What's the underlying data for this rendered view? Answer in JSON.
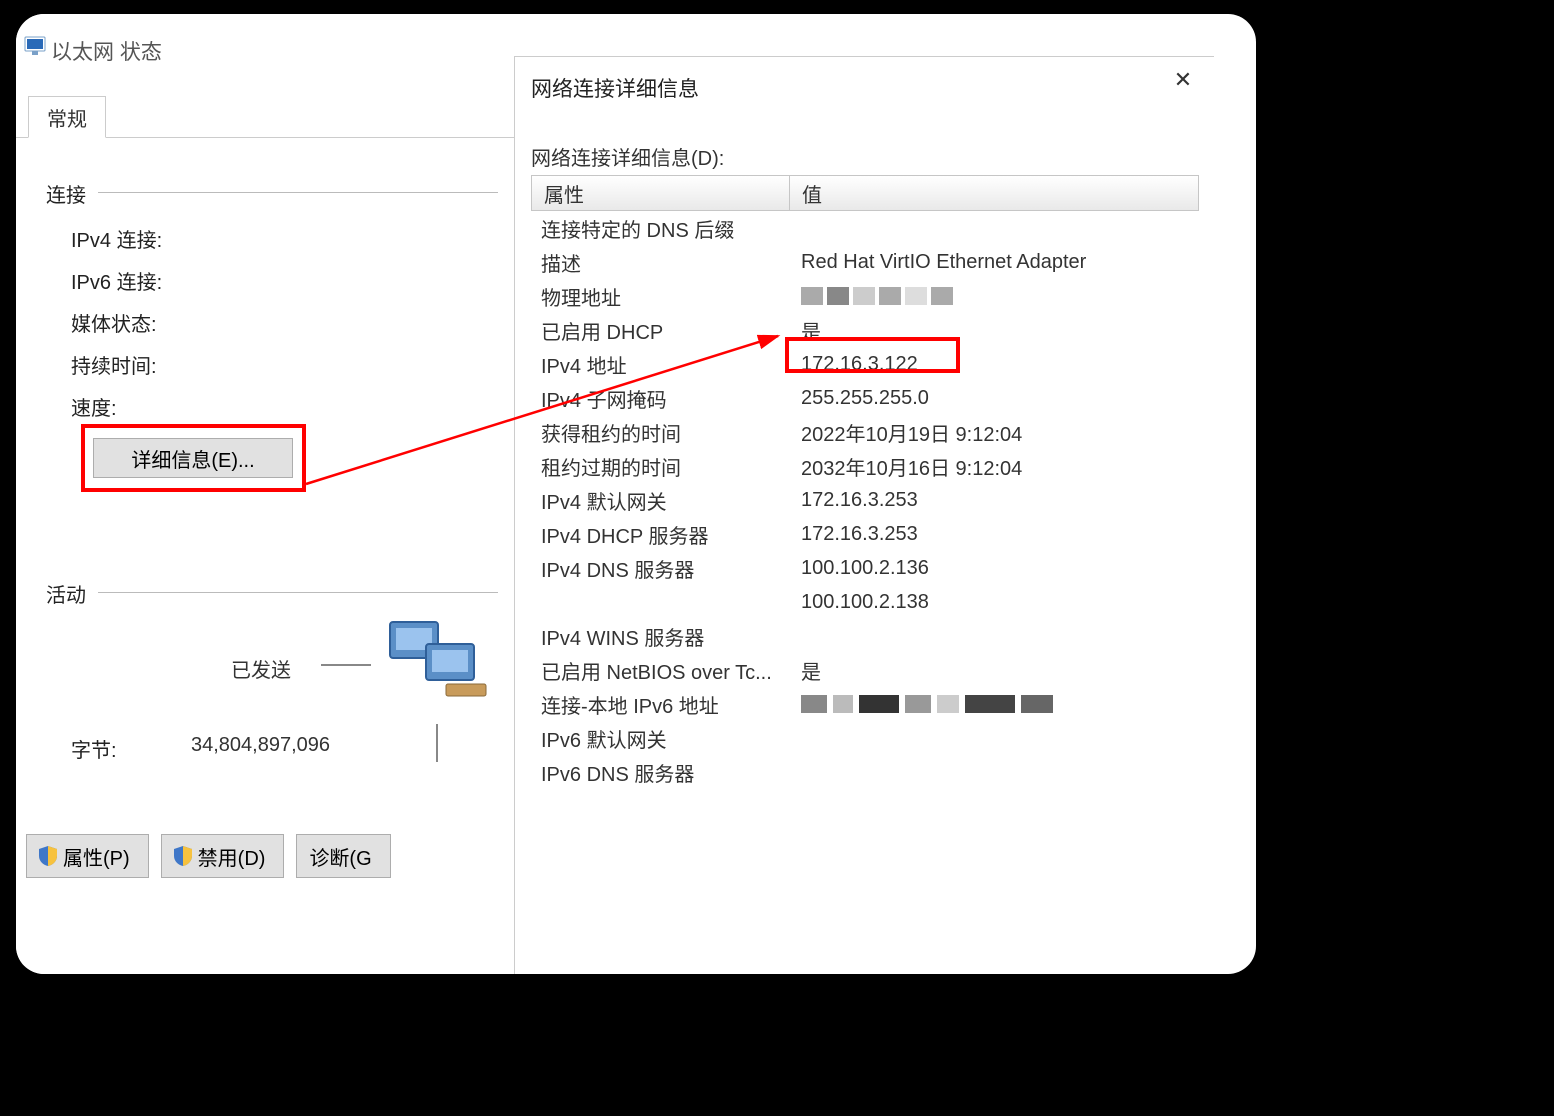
{
  "status": {
    "title": "以太网 状态",
    "tab": "常规",
    "connection_section": "连接",
    "fields": {
      "ipv4": "IPv4 连接:",
      "ipv6": "IPv6 连接:",
      "media": "媒体状态:",
      "duration": "持续时间:",
      "speed": "速度:"
    },
    "details_btn": "详细信息(E)...",
    "activity_section": "活动",
    "sent_label": "已发送",
    "bytes_label": "字节:",
    "bytes_sent": "34,804,897,096",
    "buttons": {
      "properties": "属性(P)",
      "disable": "禁用(D)",
      "diagnose": "诊断(G"
    }
  },
  "details": {
    "title": "网络连接详细信息",
    "subtitle": "网络连接详细信息(D):",
    "header_property": "属性",
    "header_value": "值",
    "rows": [
      {
        "prop": "连接特定的 DNS 后缀",
        "val": ""
      },
      {
        "prop": "描述",
        "val": "Red Hat VirtIO Ethernet Adapter"
      },
      {
        "prop": "物理地址",
        "val": "__MAC__"
      },
      {
        "prop": "已启用 DHCP",
        "val": "是"
      },
      {
        "prop": "IPv4 地址",
        "val": "172.16.3.122"
      },
      {
        "prop": "IPv4 子网掩码",
        "val": "255.255.255.0"
      },
      {
        "prop": "获得租约的时间",
        "val": "2022年10月19日 9:12:04"
      },
      {
        "prop": "租约过期的时间",
        "val": "2032年10月16日 9:12:04"
      },
      {
        "prop": "IPv4 默认网关",
        "val": "172.16.3.253"
      },
      {
        "prop": "IPv4 DHCP 服务器",
        "val": "172.16.3.253"
      },
      {
        "prop": "IPv4 DNS 服务器",
        "val": "100.100.2.136"
      },
      {
        "prop": "",
        "val": "100.100.2.138"
      },
      {
        "prop": "IPv4 WINS 服务器",
        "val": ""
      },
      {
        "prop": "已启用 NetBIOS over Tc...",
        "val": "是"
      },
      {
        "prop": "连接-本地 IPv6 地址",
        "val": "__IPV6__"
      },
      {
        "prop": "IPv6 默认网关",
        "val": ""
      },
      {
        "prop": "IPv6 DNS 服务器",
        "val": ""
      }
    ]
  }
}
